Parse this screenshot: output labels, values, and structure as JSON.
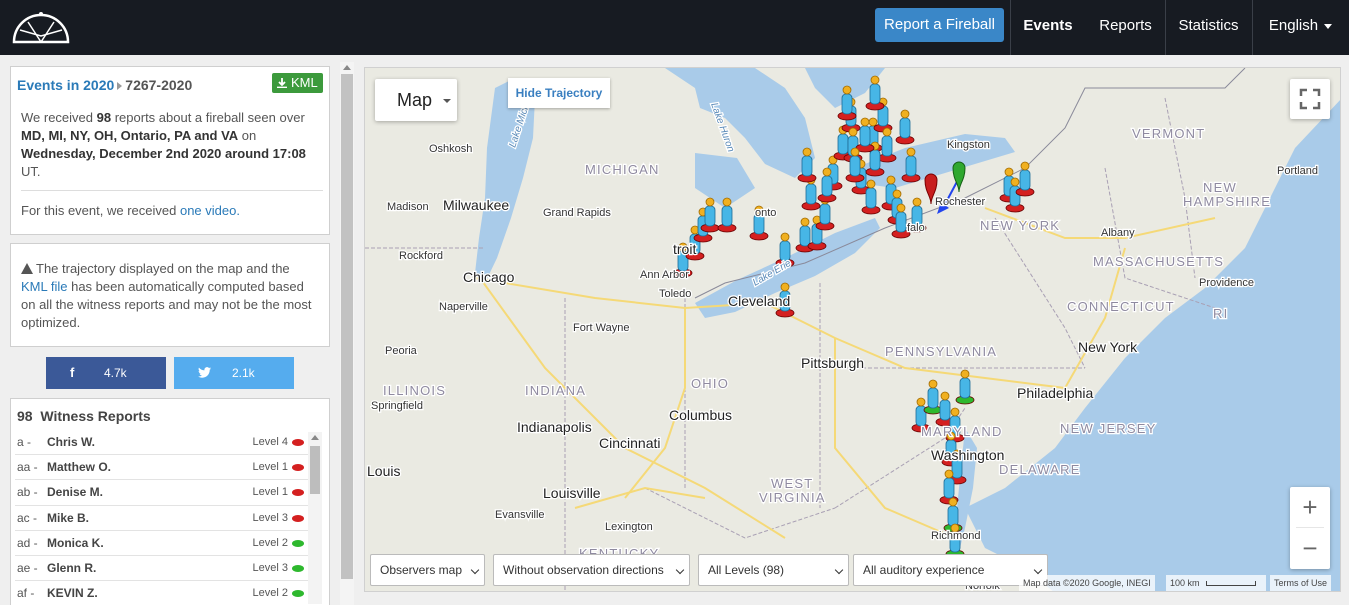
{
  "navbar": {
    "report_button": "Report a Fireball",
    "items": [
      {
        "label": "Events",
        "active": true
      },
      {
        "label": "Reports"
      },
      {
        "label": "Statistics"
      },
      {
        "label": "English"
      }
    ]
  },
  "event": {
    "breadcrumb_link": "Events in 2020",
    "event_id": "7267-2020",
    "kml_button": "KML",
    "desc_pre": "We received ",
    "report_count": "98",
    "desc_mid": " reports about a fireball seen over ",
    "regions": "MD, MI, NY, OH, Ontario, PA and VA",
    "desc_on": " on ",
    "date": "Wednesday, December 2nd 2020 around 17:08",
    "desc_tz": " UT.",
    "video_pre": "For this event, we received ",
    "video_link": "one video."
  },
  "trajectory_note": {
    "pre": "The trajectory displayed on the map and the ",
    "link": "KML file",
    "post": " has been automatically computed based on all the witness reports and may not be the most optimized."
  },
  "share": {
    "facebook_count": "4.7k",
    "twitter_count": "2.1k"
  },
  "witnesses": {
    "count": "98",
    "title": "Witness Reports",
    "rows": [
      {
        "code": "a -",
        "name": "Chris W.",
        "level": "Level 4",
        "color": "#d42020"
      },
      {
        "code": "aa -",
        "name": "Matthew O.",
        "level": "Level 1",
        "color": "#d42020"
      },
      {
        "code": "ab -",
        "name": "Denise M.",
        "level": "Level 1",
        "color": "#d42020"
      },
      {
        "code": "ac -",
        "name": "Mike B.",
        "level": "Level 3",
        "color": "#d42020"
      },
      {
        "code": "ad -",
        "name": "Monica K.",
        "level": "Level 2",
        "color": "#2eb82e"
      },
      {
        "code": "ae -",
        "name": "Glenn R.",
        "level": "Level 3",
        "color": "#2eb82e"
      },
      {
        "code": "af -",
        "name": "KEVIN Z.",
        "level": "Level 2",
        "color": "#2eb82e"
      }
    ]
  },
  "map": {
    "type_label": "Map",
    "hide_trajectory": "Hide Trajectory",
    "filters": [
      "Observers map",
      "Without observation directions",
      "All Levels (98)",
      "All auditory experience"
    ],
    "attribution": "Map data ©2020 Google, INEGI",
    "scale": "100 km",
    "terms": "Terms of Use",
    "labels": [
      {
        "text": "MICHIGAN",
        "style": "state"
      },
      {
        "text": "Lake Huron",
        "style": "water"
      },
      {
        "text": "Lake Michigan",
        "style": "water"
      },
      {
        "text": "Lake Erie",
        "style": "water"
      },
      {
        "text": "VERMONT",
        "style": "state"
      },
      {
        "text": "NEW",
        "style": "state"
      },
      {
        "text": "HAMPSHIRE",
        "style": "state"
      },
      {
        "text": "NEW YORK",
        "style": "state"
      },
      {
        "text": "MASSACHUSETTS",
        "style": "state"
      },
      {
        "text": "CONNECTICUT",
        "style": "state"
      },
      {
        "text": "RI",
        "style": "state"
      },
      {
        "text": "PENNSYLVANIA",
        "style": "state"
      },
      {
        "text": "ILLINOIS",
        "style": "state"
      },
      {
        "text": "INDIANA",
        "style": "state"
      },
      {
        "text": "OHIO",
        "style": "state"
      },
      {
        "text": "NEW JERSEY",
        "style": "state"
      },
      {
        "text": "MARYLAND",
        "style": "state"
      },
      {
        "text": "DELAWARE",
        "style": "state"
      },
      {
        "text": "WEST",
        "style": "state"
      },
      {
        "text": "VIRGINIA",
        "style": "state"
      },
      {
        "text": "KENTUCKY",
        "style": "state"
      },
      {
        "text": "Milwaukee",
        "style": "city"
      },
      {
        "text": "Chicago",
        "style": "city"
      },
      {
        "text": "Cleveland",
        "style": "city"
      },
      {
        "text": "Pittsburgh",
        "style": "city"
      },
      {
        "text": "Columbus",
        "style": "city"
      },
      {
        "text": "Indianapolis",
        "style": "city"
      },
      {
        "text": "Cincinnati",
        "style": "city"
      },
      {
        "text": "Louisville",
        "style": "city"
      },
      {
        "text": "Louis",
        "style": "city"
      },
      {
        "text": "New York",
        "style": "city"
      },
      {
        "text": "Philadelphia",
        "style": "city"
      },
      {
        "text": "Washington",
        "style": "city"
      },
      {
        "text": "troit",
        "style": "city"
      },
      {
        "text": "Oshkosh",
        "style": "town"
      },
      {
        "text": "Madison",
        "style": "town"
      },
      {
        "text": "Grand Rapids",
        "style": "town"
      },
      {
        "text": "Rockford",
        "style": "town"
      },
      {
        "text": "Naperville",
        "style": "town"
      },
      {
        "text": "Ann Arbor",
        "style": "town"
      },
      {
        "text": "Toledo",
        "style": "town"
      },
      {
        "text": "Fort Wayne",
        "style": "town"
      },
      {
        "text": "Peoria",
        "style": "town"
      },
      {
        "text": "Springfield",
        "style": "town"
      },
      {
        "text": "Evansville",
        "style": "town"
      },
      {
        "text": "Lexington",
        "style": "town"
      },
      {
        "text": "Kingston",
        "style": "town"
      },
      {
        "text": "Albany",
        "style": "town"
      },
      {
        "text": "Portland",
        "style": "town"
      },
      {
        "text": "Providence",
        "style": "town"
      },
      {
        "text": "Rochester",
        "style": "town"
      },
      {
        "text": "falo",
        "style": "town"
      },
      {
        "text": "onto",
        "style": "town"
      },
      {
        "text": "Richmond",
        "style": "town"
      },
      {
        "text": "Norfolk",
        "style": "town"
      }
    ]
  }
}
